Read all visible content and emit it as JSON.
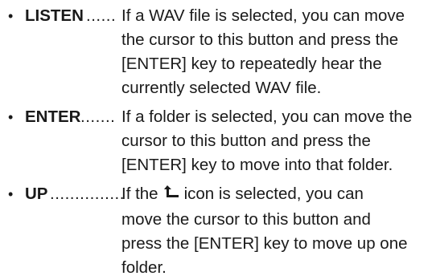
{
  "entries": [
    {
      "bullet": "•",
      "term": "LISTEN",
      "dots": "......",
      "lines": [
        "If a WAV file is selected, you can move",
        "the cursor to this button and press the",
        "[ENTER] key to repeatedly hear the",
        "currently selected WAV file."
      ]
    },
    {
      "bullet": "•",
      "term": "ENTER",
      "dots": ".......",
      "lines": [
        "If a folder is selected, you can move the",
        "cursor to this button and press the",
        "[ENTER] key to move into that folder."
      ]
    },
    {
      "bullet": "•",
      "term": "UP",
      "dots": "...............",
      "line1_before": "If the",
      "line1_after": "icon is selected, you can",
      "icon": "up-folder-arrow-icon",
      "lines": [
        "move the cursor to this button and",
        "press the [ENTER] key to move up one",
        "folder."
      ]
    }
  ]
}
